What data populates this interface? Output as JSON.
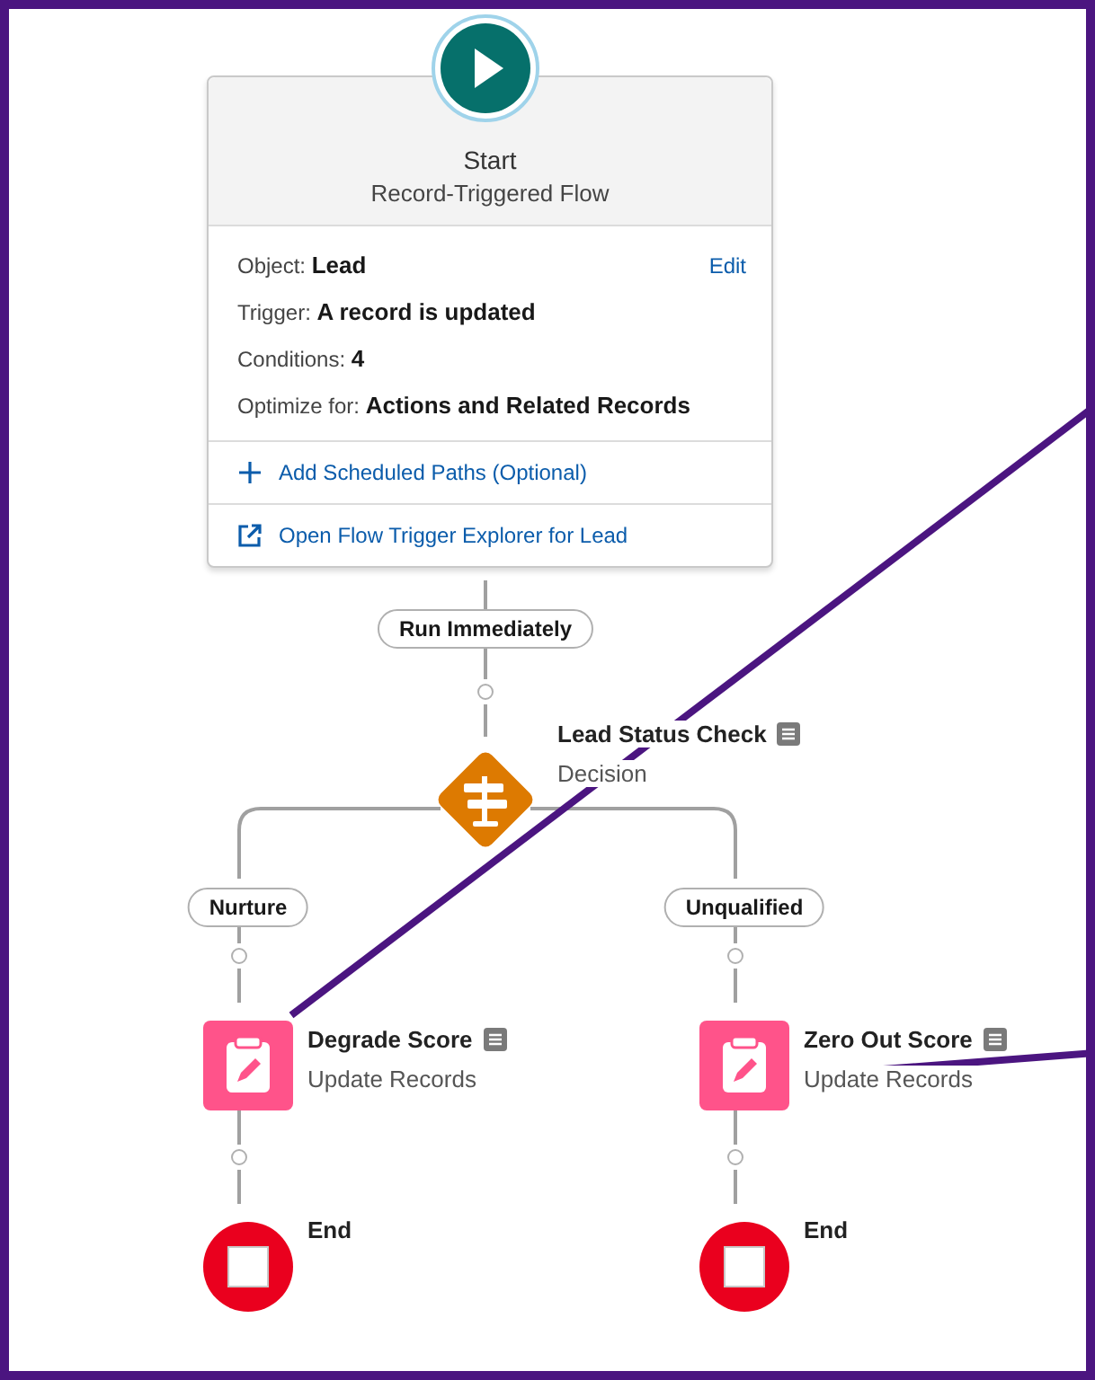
{
  "start": {
    "title": "Start",
    "subtitle": "Record-Triggered Flow",
    "edit_link": "Edit",
    "fields": [
      {
        "label": "Object:",
        "value": "Lead"
      },
      {
        "label": "Trigger:",
        "value": "A record is updated"
      },
      {
        "label": "Conditions:",
        "value": "4"
      },
      {
        "label": "Optimize for:",
        "value": "Actions and Related Records"
      }
    ],
    "actions": [
      {
        "kind": "add",
        "label": "Add Scheduled Paths (Optional)"
      },
      {
        "kind": "open",
        "label": "Open Flow Trigger Explorer for Lead"
      }
    ]
  },
  "start_path": "Run Immediately",
  "decision": {
    "name": "Lead Status Check",
    "type": "Decision"
  },
  "branches": [
    {
      "label": "Nurture",
      "element": {
        "name": "Degrade Score",
        "type": "Update Records"
      },
      "end": "End"
    },
    {
      "label": "Unqualified",
      "element": {
        "name": "Zero Out Score",
        "type": "Update Records"
      },
      "end": "End"
    }
  ]
}
